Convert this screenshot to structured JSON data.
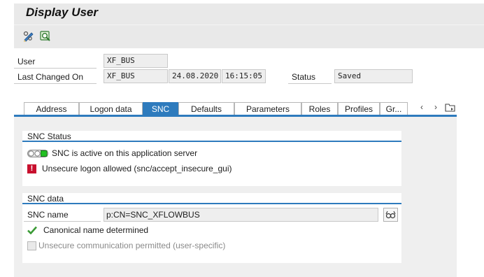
{
  "window": {
    "title": "Display User"
  },
  "toolbar": {
    "icons": [
      "change-icon",
      "other-user-icon"
    ]
  },
  "header": {
    "user_label": "User",
    "user_value": "XF_BUS",
    "last_changed_label": "Last Changed On",
    "last_changed_by": "XF_BUS",
    "last_changed_date": "24.08.2020",
    "last_changed_time": "16:15:05",
    "status_label": "Status",
    "status_value": "Saved"
  },
  "tabs": [
    {
      "label": "Address",
      "active": false
    },
    {
      "label": "Logon data",
      "active": false
    },
    {
      "label": "SNC",
      "active": true
    },
    {
      "label": "Defaults",
      "active": false
    },
    {
      "label": "Parameters",
      "active": false
    },
    {
      "label": "Roles",
      "active": false
    },
    {
      "label": "Profiles",
      "active": false
    },
    {
      "label": "Gr...",
      "active": false
    }
  ],
  "snc_status": {
    "title": "SNC Status",
    "active_text": "SNC is active on this application server",
    "unsecure_text": "Unsecure logon allowed (snc/accept_insecure_gui)"
  },
  "snc_data": {
    "title": "SNC data",
    "name_label": "SNC name",
    "name_value": "p:CN=SNC_XFLOWBUS",
    "canonical_text": "Canonical name determined",
    "unsecure_comm_label": "Unsecure communication permitted (user-specific)",
    "unsecure_comm_checked": false
  },
  "colors": {
    "accent": "#2e7bbd",
    "panel_bg": "#efefef",
    "bar_bg": "#e9e9e9",
    "error_red": "#c8102e",
    "ok_green": "#3a9a35"
  }
}
